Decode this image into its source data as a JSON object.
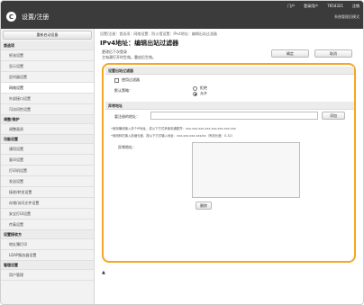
{
  "header": {
    "nav": [
      "门户",
      "登录用户",
      "7654321",
      "注销"
    ],
    "app_title": "设置/注册",
    "logo_glyph": "C",
    "admin_label": "系统管理员模式"
  },
  "sidebar": {
    "top_button": "重新启动设备",
    "groups": [
      {
        "title": "首选项",
        "items": [
          "纸张设置",
          "显示设置",
          "定时器设置",
          "网络设置",
          "外部接口设置",
          "可访问性设置"
        ]
      },
      {
        "title": "调整/维护",
        "items": [
          "调整画质"
        ]
      },
      {
        "title": "功能设置",
        "items": [
          "通用设置",
          "复印设置",
          "打印机设置",
          "发送设置",
          "接收/转发设置",
          "存储/访问文件设置",
          "安全打印设置",
          "传真设置"
        ]
      },
      {
        "title": "设置接收方",
        "items": [
          "地址簿打印",
          "LDAP服务器设置"
        ]
      },
      {
        "title": "管理设置",
        "items": [
          "用户管理"
        ]
      }
    ],
    "active_item": "网络设置"
  },
  "main": {
    "breadcrumb": "设置/注册：首选项：网络设置：防火墙设置：IPv4地址：编辑出站过滤器",
    "title": "IPv4地址：编辑出站过滤器",
    "note_lines": [
      "更改后下次登录",
      "主电源打开时生效。重启后生效。"
    ],
    "ok_label": "确定",
    "cancel_label": "取消",
    "section_filter_title": "设置出站过滤器",
    "use_filter_label": "使用过滤器",
    "default_policy_label": "默认策略：",
    "policy_options": [
      "拒绝",
      "允许"
    ],
    "policy_selected": "允许",
    "section_exception_title": "异常地址",
    "address_label": "要注册的地址：",
    "address_value": "",
    "add_label": "添加",
    "hint_1": "•使用横线输入多个IP地址，或以下方式来使用通配符：xxx.xxx.xxx.xxx-xxx.xxx.xxx.xxx",
    "hint_2": "•使用斜杠输入前缀长度，按以下方式输入地址：xxx.xxx.xxx.xxx/xx（有效长度：0-32）",
    "excluded_label": "异常地址：",
    "excluded_addresses": [],
    "delete_label": "删除",
    "to_top_glyph": "▲"
  }
}
